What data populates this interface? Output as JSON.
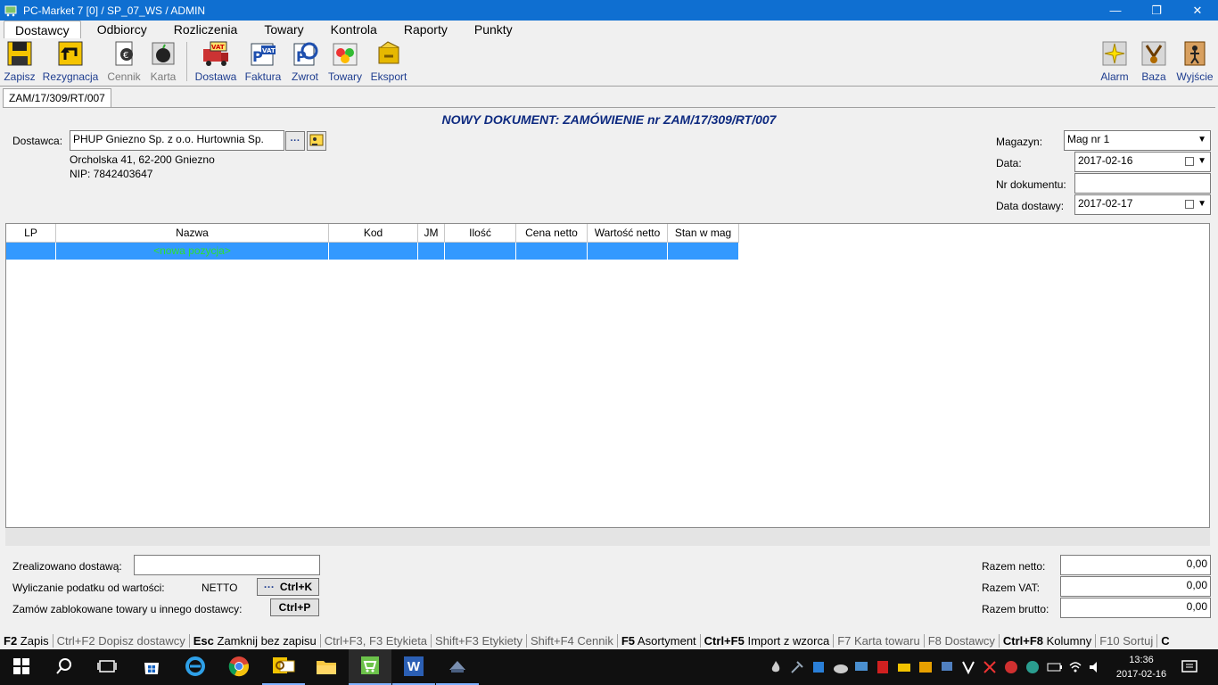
{
  "window": {
    "title": "PC-Market 7 [0] / SP_07_WS / ADMIN",
    "minimize": "—",
    "restore": "❐",
    "close": "✕"
  },
  "menu": [
    "Dostawcy",
    "Odbiorcy",
    "Rozliczenia",
    "Towary",
    "Kontrola",
    "Raporty",
    "Punkty"
  ],
  "toolbar": {
    "left": [
      {
        "label": "Zapisz",
        "icon": "floppy-save-icon",
        "enabled": true
      },
      {
        "label": "Rezygnacja",
        "icon": "undo-arrow-icon",
        "enabled": true
      },
      {
        "label": "Cennik",
        "icon": "price-list-icon",
        "enabled": false
      },
      {
        "label": "Karta",
        "icon": "apple-card-icon",
        "enabled": false
      },
      {
        "label": "Dostawa",
        "icon": "vat-truck-icon",
        "enabled": true
      },
      {
        "label": "Faktura",
        "icon": "vat-invoice-icon",
        "enabled": true
      },
      {
        "label": "Zwrot",
        "icon": "return-icon",
        "enabled": true
      },
      {
        "label": "Towary",
        "icon": "goods-basket-icon",
        "enabled": true
      },
      {
        "label": "Eksport",
        "icon": "export-icon",
        "enabled": true
      }
    ],
    "right": [
      {
        "label": "Alarm",
        "icon": "alarm-icon"
      },
      {
        "label": "Baza",
        "icon": "database-icon"
      },
      {
        "label": "Wyjście",
        "icon": "exit-door-icon"
      }
    ],
    "vat_text": "VAT",
    "p_text": "P"
  },
  "tab": {
    "label": "ZAM/17/309/RT/007"
  },
  "document": {
    "heading": "NOWY DOKUMENT: ZAMÓWIENIE nr ZAM/17/309/RT/007",
    "supplier_label": "Dostawca:",
    "supplier_value": "PHUP Gniezno Sp. z o.o. Hurtownia Sp.",
    "address": "Orcholska 41, 62-200 Gniezno",
    "nip": "NIP: 7842403647",
    "ellipsis": "···",
    "warehouse_label": "Magazyn:",
    "warehouse_value": "Mag nr 1",
    "date_label": "Data:",
    "date_value": "2017-02-16",
    "docno_label": "Nr dokumentu:",
    "docno_value": "",
    "delivery_label": "Data dostawy:",
    "delivery_value": "2017-02-17"
  },
  "grid": {
    "columns": [
      "LP",
      "Nazwa",
      "Kod",
      "JM",
      "Ilość",
      "Cena netto",
      "Wartość netto",
      "Stan w mag"
    ],
    "new_row": "<nowa pozycja>"
  },
  "footer": {
    "delivered_label": "Zrealizowano dostawą:",
    "delivered_value": "",
    "tax_label": "Wyliczanie podatku od wartości:",
    "tax_value": "NETTO",
    "tax_button": "Ctrl+K",
    "blocked_label": "Zamów zablokowane towary u innego dostawcy:",
    "blocked_button": "Ctrl+P",
    "net_label": "Razem netto:",
    "net_value": "0,00",
    "vat_label": "Razem VAT:",
    "vat_value": "0,00",
    "gross_label": "Razem brutto:",
    "gross_value": "0,00"
  },
  "shortcuts": [
    {
      "key": "F2",
      "label": "Zapis",
      "enabled": true
    },
    {
      "key": "Ctrl+F2",
      "label": "Dopisz dostawcy",
      "enabled": false
    },
    {
      "key": "Esc",
      "label": "Zamknij bez zapisu",
      "enabled": true
    },
    {
      "key": "Ctrl+F3, F3",
      "label": "Etykieta",
      "enabled": false
    },
    {
      "key": "Shift+F3",
      "label": "Etykiety",
      "enabled": false
    },
    {
      "key": "Shift+F4",
      "label": "Cennik",
      "enabled": false
    },
    {
      "key": "F5",
      "label": "Asortyment",
      "enabled": true
    },
    {
      "key": "Ctrl+F5",
      "label": "Import z wzorca",
      "enabled": true
    },
    {
      "key": "F7",
      "label": "Karta towaru",
      "enabled": false
    },
    {
      "key": "F8",
      "label": "Dostawcy",
      "enabled": false
    },
    {
      "key": "Ctrl+F8",
      "label": "Kolumny",
      "enabled": true
    },
    {
      "key": "F10",
      "label": "Sortuj",
      "enabled": false
    },
    {
      "key": "C",
      "label": "",
      "enabled": true
    }
  ],
  "taskbar": {
    "apps": [
      "start-icon",
      "search-icon",
      "task-view-icon",
      "store-icon",
      "ie-icon",
      "chrome-icon",
      "outlook-icon",
      "explorer-icon",
      "pcmarket-icon",
      "word-icon",
      "network-tool-icon"
    ],
    "time": "13:36",
    "date": "2017-02-16",
    "word_letter": "W"
  }
}
